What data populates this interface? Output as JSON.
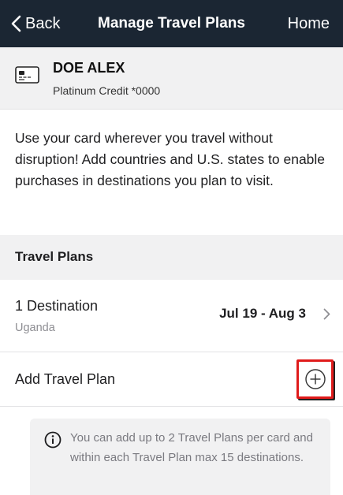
{
  "nav": {
    "back_label": "Back",
    "title": "Manage Travel Plans",
    "home_label": "Home"
  },
  "card": {
    "holder_name": "DOE ALEX",
    "description": "Platinum Credit *0000"
  },
  "intro_text": "Use your card wherever you travel without disruption! Add countries and U.S. states to enable purchases in destinations you plan to visit.",
  "travel_plans": {
    "section_title": "Travel Plans",
    "plans": [
      {
        "destination_count": "1 Destination",
        "destinations": "Uganda",
        "dates": "Jul 19 - Aug 3"
      }
    ],
    "add_label": "Add Travel Plan"
  },
  "info_note": "You can add up to 2 Travel Plans per card and within each Travel Plan max 15 destinations.",
  "colors": {
    "navbar_bg": "#1b2633",
    "section_bg": "#f1f1f2",
    "highlight": "#e01b1b"
  },
  "icons": {
    "back": "chevron-left-icon",
    "card": "credit-card-icon",
    "row_chevron": "chevron-right-icon",
    "add": "plus-circle-icon",
    "info": "info-circle-icon"
  }
}
